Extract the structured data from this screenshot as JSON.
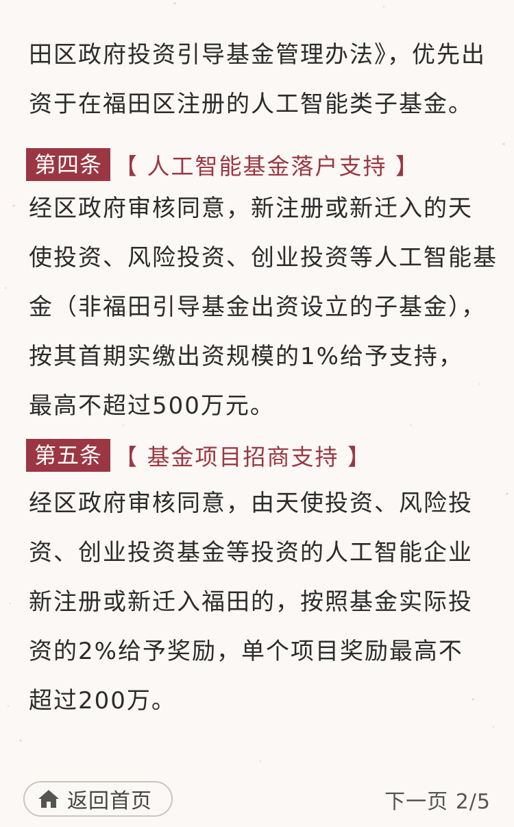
{
  "intro": {
    "lines": [
      "田区政府投资引导基金管理办法》，优先出",
      "资于在福田区注册的人工智能类子基金。"
    ]
  },
  "article4": {
    "badge": "第四条",
    "title": "【 人工智能基金落户支持 】",
    "lines": [
      "经区政府审核同意，新注册或新迁入的天",
      "使投资、风险投资、创业投资等人工智能基",
      "金（非福田引导基金出资设立的子基金），",
      "按其首期实缴出资规模的1%给予支持，",
      "最高不超过500万元。"
    ]
  },
  "article5": {
    "badge": "第五条",
    "title": "【 基金项目招商支持 】",
    "lines": [
      "经区政府审核同意，由天使投资、风险投",
      "资、创业投资基金等投资的人工智能企业",
      "新注册或新迁入福田的，按照基金实际投",
      "资的2%给予奖励，单个项目奖励最高不",
      "超过200万。"
    ]
  },
  "footer": {
    "home_label": "返回首页",
    "home_icon": "home-icon",
    "next_label": "下一页",
    "page_indicator": "2/5"
  },
  "colors": {
    "accent": "#9b3742",
    "background": "#fbf8f5",
    "text": "#2b2b2b"
  }
}
